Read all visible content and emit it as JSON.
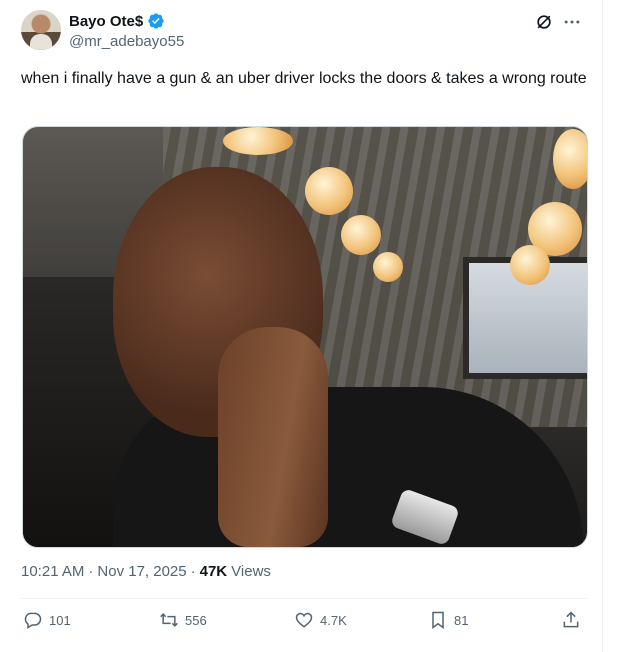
{
  "author": {
    "display_name": "Bayo Ote$",
    "handle": "@mr_adebayo55",
    "verified": true,
    "avatar_icon": "avatar"
  },
  "tweet": {
    "text": "when i finally have a gun & an uber driver locks the doors & takes a wrong route",
    "image_alt": "photo-of-smiling-man-with-hands-pressed-together"
  },
  "meta": {
    "time": "10:21 AM",
    "separator1": "·",
    "date": "Nov 17, 2025",
    "separator2": "·",
    "views_count": "47K",
    "views_label": "Views"
  },
  "actions": {
    "replies": "101",
    "reposts": "556",
    "likes": "4.7K",
    "bookmarks": "81"
  },
  "colors": {
    "text": "#0f1419",
    "secondary": "#536471",
    "verified": "#1d9bf0",
    "divider": "#eff3f4"
  },
  "icons": {
    "verified": "verified-badge-icon",
    "grok": "grok-icon",
    "more": "more-icon",
    "reply": "reply-icon",
    "repost": "repost-icon",
    "like": "heart-icon",
    "bookmark": "bookmark-icon",
    "share": "share-icon"
  }
}
